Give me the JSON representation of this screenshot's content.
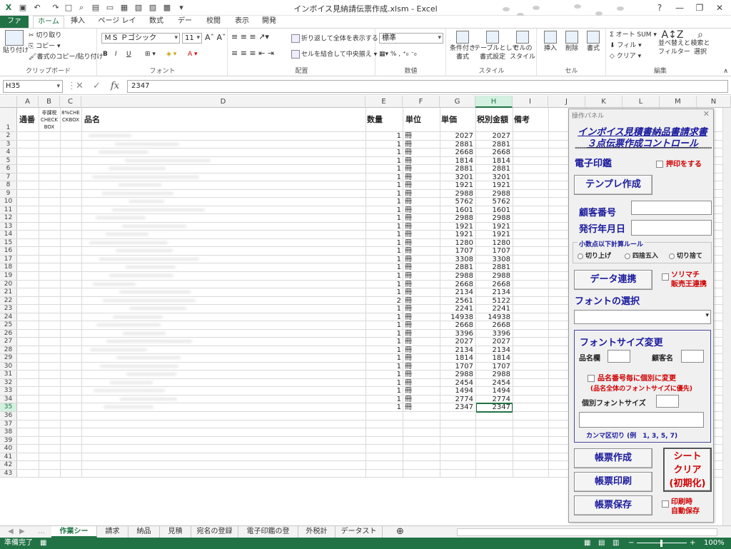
{
  "titlebar": {
    "title": "インボイス見納請伝票作成.xlsm - Excel",
    "help": "?",
    "min": "—",
    "restore": "❐",
    "close": "✕"
  },
  "tabs": [
    "ファイル",
    "ホーム",
    "挿入",
    "ページ レイアウト",
    "数式",
    "データ",
    "校閲",
    "表示",
    "開発"
  ],
  "ribbon": {
    "clipboard": {
      "paste": "貼り付け",
      "cut": "切り取り",
      "copy": "コピー",
      "format_painter": "書式のコピー/貼り付け",
      "label": "クリップボード"
    },
    "font": {
      "name": "ＭＳ Ｐゴシック",
      "size": "11",
      "bold": "B",
      "italic": "I",
      "underline": "U",
      "label": "フォント"
    },
    "align": {
      "wrap": "折り返して全体を表示する",
      "merge": "セルを結合して中央揃え",
      "label": "配置"
    },
    "number": {
      "format": "標準",
      "label": "数値"
    },
    "styles": {
      "cond": "条件付き\n書式",
      "table": "テーブルとして\n書式設定",
      "cell": "セルの\nスタイル",
      "label": "スタイル"
    },
    "cells": {
      "insert": "挿入",
      "delete": "削除",
      "format": "書式",
      "label": "セル"
    },
    "edit": {
      "autosum": "オート SUM",
      "fill": "フィル",
      "clear": "クリア",
      "sort": "並べ替えと\nフィルター",
      "find": "検索と\n選択",
      "label": "編集"
    }
  },
  "formula": {
    "namebox": "H35",
    "value": "2347"
  },
  "columns": [
    "A",
    "B",
    "C",
    "D",
    "E",
    "F",
    "G",
    "H",
    "I",
    "J",
    "K",
    "L",
    "M",
    "N"
  ],
  "header": {
    "a": "通番",
    "b": "非課税\nCHECK\nBOX",
    "c": "8%CHE\nCKBOX",
    "d": "品名",
    "e": "数量",
    "f": "単位",
    "g": "単価",
    "h": "税別金額",
    "i": "備考"
  },
  "rows": [
    {
      "n": "2",
      "q": "1",
      "u": "冊",
      "p": "2027",
      "t": "2027"
    },
    {
      "n": "3",
      "q": "1",
      "u": "冊",
      "p": "2881",
      "t": "2881"
    },
    {
      "n": "4",
      "q": "1",
      "u": "冊",
      "p": "2668",
      "t": "2668"
    },
    {
      "n": "5",
      "q": "1",
      "u": "冊",
      "p": "1814",
      "t": "1814"
    },
    {
      "n": "6",
      "q": "1",
      "u": "冊",
      "p": "2881",
      "t": "2881"
    },
    {
      "n": "7",
      "q": "1",
      "u": "冊",
      "p": "3201",
      "t": "3201"
    },
    {
      "n": "8",
      "q": "1",
      "u": "冊",
      "p": "1921",
      "t": "1921"
    },
    {
      "n": "9",
      "q": "1",
      "u": "冊",
      "p": "2988",
      "t": "2988"
    },
    {
      "n": "10",
      "q": "1",
      "u": "冊",
      "p": "5762",
      "t": "5762"
    },
    {
      "n": "11",
      "q": "1",
      "u": "冊",
      "p": "1601",
      "t": "1601"
    },
    {
      "n": "12",
      "q": "1",
      "u": "冊",
      "p": "2988",
      "t": "2988"
    },
    {
      "n": "13",
      "q": "1",
      "u": "冊",
      "p": "1921",
      "t": "1921"
    },
    {
      "n": "14",
      "q": "1",
      "u": "冊",
      "p": "1921",
      "t": "1921"
    },
    {
      "n": "15",
      "q": "1",
      "u": "冊",
      "p": "1280",
      "t": "1280"
    },
    {
      "n": "16",
      "q": "1",
      "u": "冊",
      "p": "1707",
      "t": "1707"
    },
    {
      "n": "17",
      "q": "1",
      "u": "冊",
      "p": "3308",
      "t": "3308"
    },
    {
      "n": "18",
      "q": "1",
      "u": "冊",
      "p": "2881",
      "t": "2881"
    },
    {
      "n": "19",
      "q": "1",
      "u": "冊",
      "p": "2988",
      "t": "2988"
    },
    {
      "n": "20",
      "q": "1",
      "u": "冊",
      "p": "2668",
      "t": "2668"
    },
    {
      "n": "21",
      "q": "1",
      "u": "冊",
      "p": "2134",
      "t": "2134"
    },
    {
      "n": "22",
      "q": "2",
      "u": "冊",
      "p": "2561",
      "t": "5122"
    },
    {
      "n": "23",
      "q": "1",
      "u": "冊",
      "p": "2241",
      "t": "2241"
    },
    {
      "n": "24",
      "q": "1",
      "u": "冊",
      "p": "14938",
      "t": "14938"
    },
    {
      "n": "25",
      "q": "1",
      "u": "冊",
      "p": "2668",
      "t": "2668"
    },
    {
      "n": "26",
      "q": "1",
      "u": "冊",
      "p": "3396",
      "t": "3396"
    },
    {
      "n": "27",
      "q": "1",
      "u": "冊",
      "p": "2027",
      "t": "2027"
    },
    {
      "n": "28",
      "q": "1",
      "u": "冊",
      "p": "2134",
      "t": "2134"
    },
    {
      "n": "29",
      "q": "1",
      "u": "冊",
      "p": "1814",
      "t": "1814"
    },
    {
      "n": "30",
      "q": "1",
      "u": "冊",
      "p": "1707",
      "t": "1707"
    },
    {
      "n": "31",
      "q": "1",
      "u": "冊",
      "p": "2988",
      "t": "2988"
    },
    {
      "n": "32",
      "q": "1",
      "u": "冊",
      "p": "2454",
      "t": "2454"
    },
    {
      "n": "33",
      "q": "1",
      "u": "冊",
      "p": "1494",
      "t": "1494"
    },
    {
      "n": "34",
      "q": "1",
      "u": "冊",
      "p": "2774",
      "t": "2774"
    },
    {
      "n": "35",
      "q": "1",
      "u": "冊",
      "p": "2347",
      "t": "2347"
    }
  ],
  "empty_rows": [
    "36",
    "37",
    "38",
    "39",
    "40",
    "41",
    "42",
    "43"
  ],
  "first_row_num": "1",
  "sheets": [
    "作業シート",
    "請求書",
    "納品書",
    "見積書",
    "宛名の登録",
    "電子印鑑の登録",
    "外税計算",
    "データストック"
  ],
  "status": {
    "ready": "準備完了",
    "zoom": "100%"
  },
  "panel": {
    "window_title": "操作パネル",
    "close": "✕",
    "title1": "インボイス見積書納品書請求書",
    "title2": "３点伝票作成コントロール",
    "stars": "************************************************************************",
    "stamp_label": "電子印鑑",
    "stamp_check": "押印をする",
    "template_btn": "テンプレ作成",
    "customer_no": "顧客番号",
    "issue_date": "発行年月日",
    "rounding_title": "小数点以下計算ルール",
    "round_up": "切り上げ",
    "round_half": "四捨五入",
    "round_down": "切り捨て",
    "data_link_btn": "データ連携",
    "sorimachi": "ソリマチ\n販売王連携",
    "font_select": "フォントの選択",
    "fontsize_title": "フォントサイズ変更",
    "item_col": "品名欄",
    "cust_name": "顧客名",
    "per_item": "品名番号毎に個別に変更",
    "per_item_note": "(品名全体のフォントサイズに優先)",
    "individual": "個別フォントサイズ",
    "comma_note": "カンマ区切り (例　1, 3, 5, 7)",
    "create_btn": "帳票作成",
    "print_btn": "帳票印刷",
    "save_btn": "帳票保存",
    "clear_btn": "シート\nクリア\n(初期化)",
    "autosave": "印刷時\n自動保存"
  }
}
